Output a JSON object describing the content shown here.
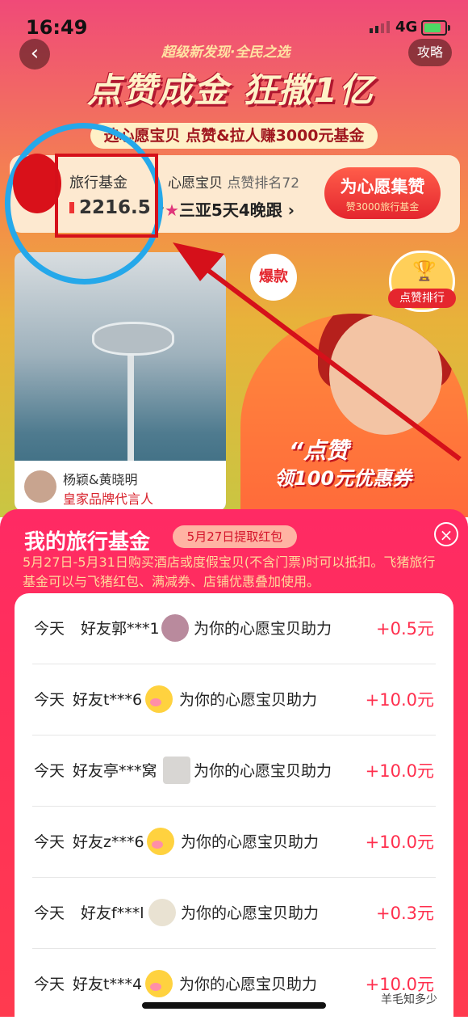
{
  "status": {
    "time": "16:49",
    "network": "4G"
  },
  "nav": {
    "guide": "攻略",
    "back_glyph": "‹"
  },
  "banner": {
    "kicker": "超级新发现·全民之选",
    "headline": "点赞成金 狂撒1亿",
    "subtitle": "选心愿宝贝 点赞&拉人赚3000元基金"
  },
  "fund_card": {
    "label": "旅行基金",
    "amount": "2216.5 ›",
    "wish_label": "心愿宝贝",
    "wish_rank": "点赞排名72",
    "wish_item": "三亚5天4晚跟 ›",
    "vote_button": "为心愿集赞",
    "vote_sub": "赞3000旅行基金"
  },
  "feed": {
    "celeb_name": "杨颖&黄晓明",
    "celeb_role": "皇家品牌代言人",
    "hot_tag": "爆款",
    "rank_badge": "点赞排行",
    "promo_line1": "“点赞",
    "promo_line2": "领100元优惠券"
  },
  "sheet": {
    "title": "我的旅行基金",
    "badge": "5月27日提取红包",
    "close_glyph": "×",
    "description": "5月27日-5月31日购买酒店或度假宝贝(不含门票)时可以抵扣。飞猪旅行基金可以与飞猪红包、满减券、店铺优惠叠加使用。",
    "rows": [
      {
        "day": "今天",
        "friend": "好友郭***1",
        "text": "为你的心愿宝贝助力",
        "amount": "+0.5元"
      },
      {
        "day": "今天",
        "friend": "好友t***6",
        "text": "为你的心愿宝贝助力",
        "amount": "+10.0元"
      },
      {
        "day": "今天",
        "friend": "好友亭***窝",
        "text": "为你的心愿宝贝助力",
        "amount": "+10.0元"
      },
      {
        "day": "今天",
        "friend": "好友z***6",
        "text": "为你的心愿宝贝助力",
        "amount": "+10.0元"
      },
      {
        "day": "今天",
        "friend": "好友f***l",
        "text": "为你的心愿宝贝助力",
        "amount": "+0.3元"
      },
      {
        "day": "今天",
        "friend": "好友t***4",
        "text": "为你的心愿宝贝助力",
        "amount": "+10.0元"
      }
    ]
  },
  "watermark": "羊毛知多少",
  "colors": {
    "accent": "#ff2e4d",
    "annotation_box": "#d5101a",
    "annotation_circle": "#25a8ea"
  }
}
